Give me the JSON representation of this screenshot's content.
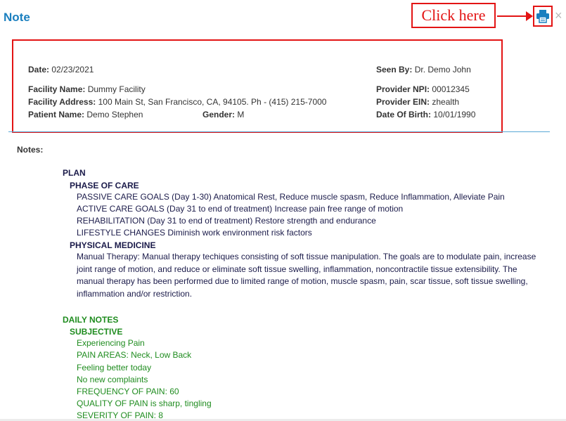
{
  "dialog": {
    "title": "Note",
    "annotation_text": "Click here",
    "print_icon": "printer-icon",
    "close_icon": "close-icon",
    "close_glyph": "×"
  },
  "header": {
    "date_label": "Date:",
    "date": "02/23/2021",
    "seen_by_label": "Seen By:",
    "seen_by": "Dr. Demo John",
    "facility_name_label": "Facility Name:",
    "facility_name": "Dummy Facility",
    "provider_npi_label": "Provider NPI:",
    "provider_npi": "00012345",
    "facility_address_label": "Facility Address:",
    "facility_address": "100 Main St, San Francisco, CA, 94105. Ph - (415) 215-7000",
    "provider_ein_label": "Provider EIN:",
    "provider_ein": "zhealth",
    "patient_name_label": "Patient Name:",
    "patient_name": "Demo Stephen",
    "gender_label": "Gender:",
    "gender": "M",
    "dob_label": "Date Of Birth:",
    "dob": "10/01/1990"
  },
  "notes": {
    "label": "Notes:",
    "plan": {
      "title": "PLAN",
      "phase_title": "PHASE OF CARE",
      "phase_lines": [
        "PASSIVE CARE GOALS (Day 1-30) Anatomical Rest, Reduce muscle spasm, Reduce Inflammation, Alleviate Pain",
        "ACTIVE CARE GOALS (Day 31 to end of treatment) Increase pain free range of motion",
        "REHABILITATION (Day 31 to end of treatment) Restore strength and endurance",
        "LIFESTYLE CHANGES Diminish work environment risk factors"
      ],
      "physical_title": "PHYSICAL MEDICINE",
      "physical_text": "Manual Therapy: Manual therapy techiques consisting of soft tissue manipulation. The goals are to modulate pain, increase joint range of motion, and reduce or eliminate soft tissue swelling, inflammation, noncontractile tissue extensibility. The manual therapy has been performed due to limited range of motion, muscle spasm, pain, scar tissue, soft tissue swelling, inflammation and/or restriction."
    },
    "daily": {
      "title": "DAILY NOTES",
      "subjective_title": "SUBJECTIVE",
      "lines": [
        "Experiencing Pain",
        "PAIN AREAS: Neck, Low Back",
        "Feeling better today",
        "No new complaints",
        "FREQUENCY OF PAIN: 60",
        "QUALITY OF PAIN is sharp, tingling",
        "SEVERITY OF PAIN: 8"
      ]
    }
  },
  "colors": {
    "title_blue": "#1a7fbf",
    "annotation_red": "#e31414",
    "plan_navy": "#1b1b4a",
    "daily_green": "#1f8c1f"
  }
}
